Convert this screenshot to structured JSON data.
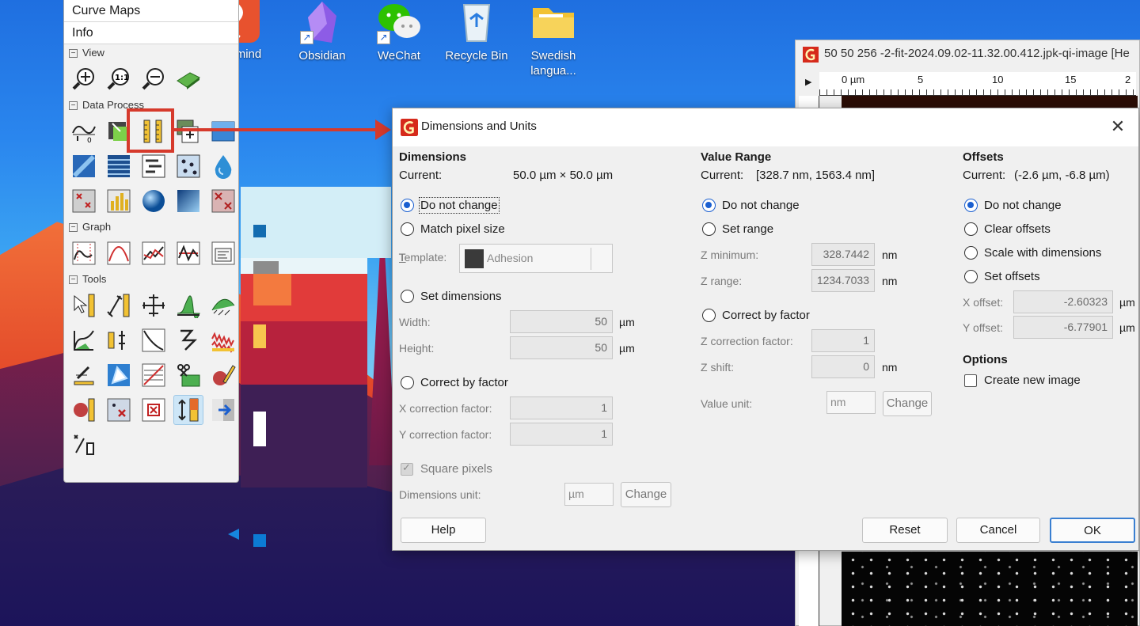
{
  "desktop": {
    "icons": [
      {
        "label_line1": "mind",
        "label_line2": "",
        "icon": "xmind-app-icon"
      },
      {
        "label_line1": "Obsidian",
        "label_line2": "",
        "icon": "obsidian-app-icon"
      },
      {
        "label_line1": "WeChat",
        "label_line2": "",
        "icon": "wechat-app-icon"
      },
      {
        "label_line1": "Recycle Bin",
        "label_line2": "",
        "icon": "recycle-bin-icon"
      },
      {
        "label_line1": "Swedish",
        "label_line2": "langua...",
        "icon": "folder-icon"
      }
    ],
    "shortcut_glyph": "↗"
  },
  "toolbox": {
    "menu": [
      "Curve Maps",
      "Info"
    ],
    "sections": {
      "view": "View",
      "data_process": "Data Process",
      "graph": "Graph",
      "tools": "Tools"
    },
    "expander": "−"
  },
  "image_window": {
    "title": "50 50 256 -2-fit-2024.09.02-11.32.00.412.jpk-qi-image [He",
    "ruler_labels": [
      "0 µm",
      "5",
      "10",
      "15",
      "2"
    ]
  },
  "dialog": {
    "title": "Dimensions and Units",
    "close_glyph": "✕",
    "dimensions": {
      "header": "Dimensions",
      "current_label": "Current:",
      "current_value": "50.0 µm × 50.0 µm",
      "opt_no_change": "Do not change",
      "opt_match_pixel": "Match pixel size",
      "template_label": "Template:",
      "template_value": "Adhesion",
      "opt_set_dimensions": "Set dimensions",
      "width_label": "Width:",
      "width_value": "50",
      "height_label": "Height:",
      "height_value": "50",
      "unit": "µm",
      "opt_correct_factor": "Correct by factor",
      "x_factor_label": "X correction factor:",
      "x_factor_value": "1",
      "y_factor_label": "Y correction factor:",
      "y_factor_value": "1",
      "square_pixels": "Square pixels",
      "dim_unit_label": "Dimensions unit:",
      "dim_unit_value": "µm",
      "change": "Change"
    },
    "value_range": {
      "header": "Value Range",
      "current_label": "Current:",
      "current_value": "[328.7 nm, 1563.4 nm]",
      "opt_no_change": "Do not change",
      "opt_set_range": "Set range",
      "zmin_label": "Z minimum:",
      "zmin_value": "328.7442",
      "zrange_label": "Z range:",
      "zrange_value": "1234.7033",
      "unit": "nm",
      "opt_correct_factor": "Correct by factor",
      "zfactor_label": "Z correction factor:",
      "zfactor_value": "1",
      "zshift_label": "Z shift:",
      "zshift_value": "0",
      "value_unit_label": "Value unit:",
      "value_unit_value": "nm",
      "change": "Change"
    },
    "offsets": {
      "header": "Offsets",
      "current_label": "Current:",
      "current_value": "(-2.6 µm, -6.8 µm)",
      "opt_no_change": "Do not change",
      "opt_clear": "Clear offsets",
      "opt_scale": "Scale with dimensions",
      "opt_set": "Set offsets",
      "x_label": "X offset:",
      "x_value": "-2.60323",
      "y_label": "Y offset:",
      "y_value": "-6.77901",
      "unit": "µm"
    },
    "options": {
      "header": "Options",
      "create_new_image": "Create new image"
    },
    "buttons": {
      "help": "Help",
      "reset": "Reset",
      "cancel": "Cancel",
      "ok": "OK"
    }
  },
  "colors": {
    "highlight": "#d63a2c",
    "accent": "#1a5fd0"
  }
}
